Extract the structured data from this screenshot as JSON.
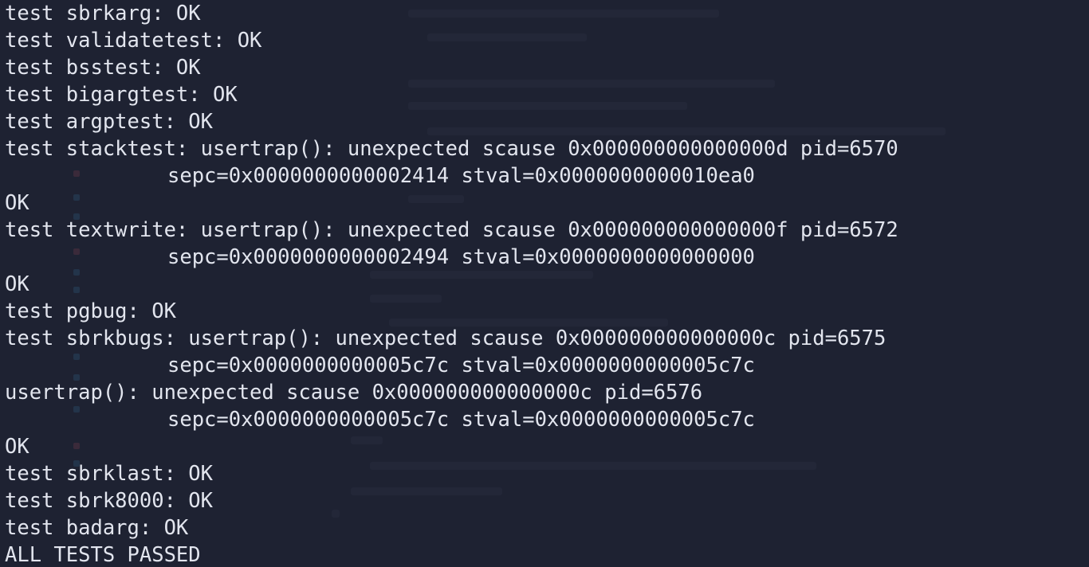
{
  "terminal": {
    "lines": [
      {
        "text": "test sbrkarg: OK",
        "indent": false
      },
      {
        "text": "test validatetest: OK",
        "indent": false
      },
      {
        "text": "test bsstest: OK",
        "indent": false
      },
      {
        "text": "test bigargtest: OK",
        "indent": false
      },
      {
        "text": "test argptest: OK",
        "indent": false
      },
      {
        "text": "test stacktest: usertrap(): unexpected scause 0x000000000000000d pid=6570",
        "indent": false
      },
      {
        "text": "sepc=0x0000000000002414 stval=0x0000000000010ea0",
        "indent": true
      },
      {
        "text": "OK",
        "indent": false
      },
      {
        "text": "test textwrite: usertrap(): unexpected scause 0x000000000000000f pid=6572",
        "indent": false
      },
      {
        "text": "sepc=0x0000000000002494 stval=0x0000000000000000",
        "indent": true
      },
      {
        "text": "OK",
        "indent": false
      },
      {
        "text": "test pgbug: OK",
        "indent": false
      },
      {
        "text": "test sbrkbugs: usertrap(): unexpected scause 0x000000000000000c pid=6575",
        "indent": false
      },
      {
        "text": "sepc=0x0000000000005c7c stval=0x0000000000005c7c",
        "indent": true
      },
      {
        "text": "usertrap(): unexpected scause 0x000000000000000c pid=6576",
        "indent": false
      },
      {
        "text": "sepc=0x0000000000005c7c stval=0x0000000000005c7c",
        "indent": true
      },
      {
        "text": "OK",
        "indent": false
      },
      {
        "text": "test sbrklast: OK",
        "indent": false
      },
      {
        "text": "test sbrk8000: OK",
        "indent": false
      },
      {
        "text": "test badarg: OK",
        "indent": false
      },
      {
        "text": "ALL TESTS PASSED",
        "indent": false
      }
    ]
  },
  "colors": {
    "background": "#1e2232",
    "foreground": "#e2e5ee"
  }
}
